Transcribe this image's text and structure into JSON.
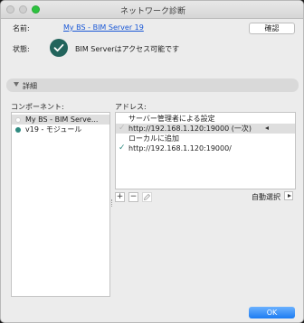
{
  "window": {
    "title": "ネットワーク診断"
  },
  "server": {
    "name_label": "名前:",
    "name_value": "My BS - BIM Server 19",
    "confirm_button": "確認",
    "status_label": "状態:",
    "status_value": "BIM Serverはアクセス可能です",
    "status_icon": "checkmark-circle-icon"
  },
  "details": {
    "label": "詳細",
    "expanded": true
  },
  "components": {
    "header": "コンポーネント:",
    "items": [
      {
        "label": "My BS - BIM Serve...",
        "selected": true
      },
      {
        "label": "v19 - モジュール",
        "selected": false
      }
    ]
  },
  "addresses": {
    "header": "アドレス:",
    "groups": [
      {
        "group_label": "サーバー管理者による設定",
        "items": [
          {
            "url": "http://192.168.1.120:19000 (一次)",
            "checked": false,
            "selected": true
          }
        ]
      },
      {
        "group_label": "ローカルに追加",
        "items": [
          {
            "url": "http://192.168.1.120:19000/",
            "checked": true,
            "selected": false
          }
        ]
      }
    ],
    "toolbar": {
      "add": "+",
      "remove": "−",
      "edit_icon": "pencil-icon"
    },
    "auto_select_label": "自動選択"
  },
  "footer": {
    "ok_button": "OK"
  },
  "colors": {
    "accent": "#1c7cf2",
    "link": "#1a58d6",
    "status_icon": "#22645c",
    "module_dot": "#2f8a80"
  }
}
